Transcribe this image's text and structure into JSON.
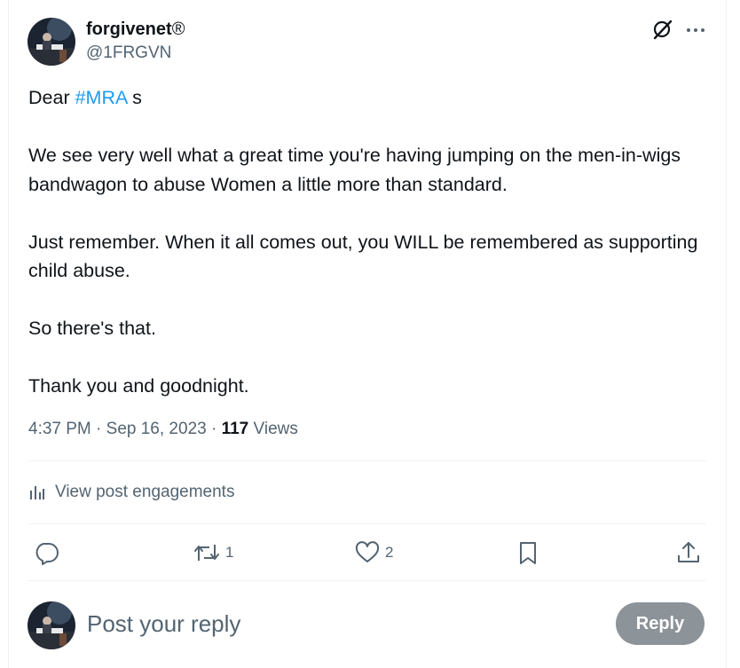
{
  "tweet": {
    "author": {
      "display_name": "forgivenet",
      "badge": "®",
      "handle": "@1FRGVN"
    },
    "body": {
      "line1_prefix": "Dear ",
      "hashtag": "#MRA",
      "line1_suffix": " s",
      "paragraph2": "We see very well what a great time you're having jumping on the men-in-wigs bandwagon to abuse Women a little more than standard.",
      "paragraph3": "Just remember. When it all comes out, you WILL be remembered as supporting child abuse.",
      "paragraph4": "So there's that.",
      "paragraph5": "Thank you and goodnight."
    },
    "meta": {
      "time": "4:37 PM",
      "separator": " · ",
      "date": "Sep 16, 2023",
      "separator2": " · ",
      "views_count": "117",
      "views_label": " Views"
    },
    "engagements_label": "View post engagements",
    "actions": {
      "reply_count": "",
      "retweet_count": "1",
      "like_count": "2"
    }
  },
  "reply_box": {
    "placeholder": "Post your reply",
    "button_label": "Reply"
  },
  "icons": {
    "grok": "grok-icon",
    "more": "more-icon",
    "analytics": "analytics-icon",
    "reply": "reply-icon",
    "retweet": "retweet-icon",
    "like": "heart-icon",
    "bookmark": "bookmark-icon",
    "share": "share-icon"
  },
  "colors": {
    "accent": "#1d9bf0",
    "secondary_text": "#536471",
    "reply_button_bg": "#8c9399",
    "divider": "#eff3f4"
  }
}
